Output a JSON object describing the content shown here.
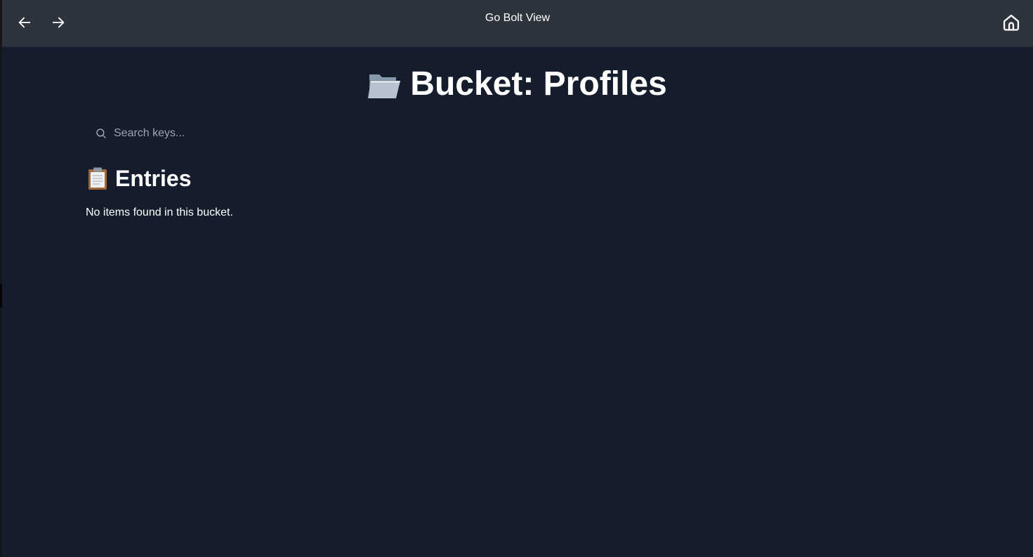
{
  "app": {
    "title": "Go Bolt View"
  },
  "nav": {
    "back_icon": "arrow-left-icon",
    "forward_icon": "arrow-right-icon",
    "home_icon": "home-icon"
  },
  "page": {
    "title_icon": "folder-icon",
    "title": "Bucket: Profiles"
  },
  "search": {
    "icon": "search-icon",
    "placeholder": "Search keys...",
    "value": ""
  },
  "entries": {
    "icon": "clipboard-icon",
    "heading": "Entries",
    "empty_message": "No items found in this bucket.",
    "items": []
  },
  "colors": {
    "topbar": "#2e343e",
    "background": "#151d2c",
    "text": "#ffffff",
    "placeholder": "#9ca3af"
  }
}
